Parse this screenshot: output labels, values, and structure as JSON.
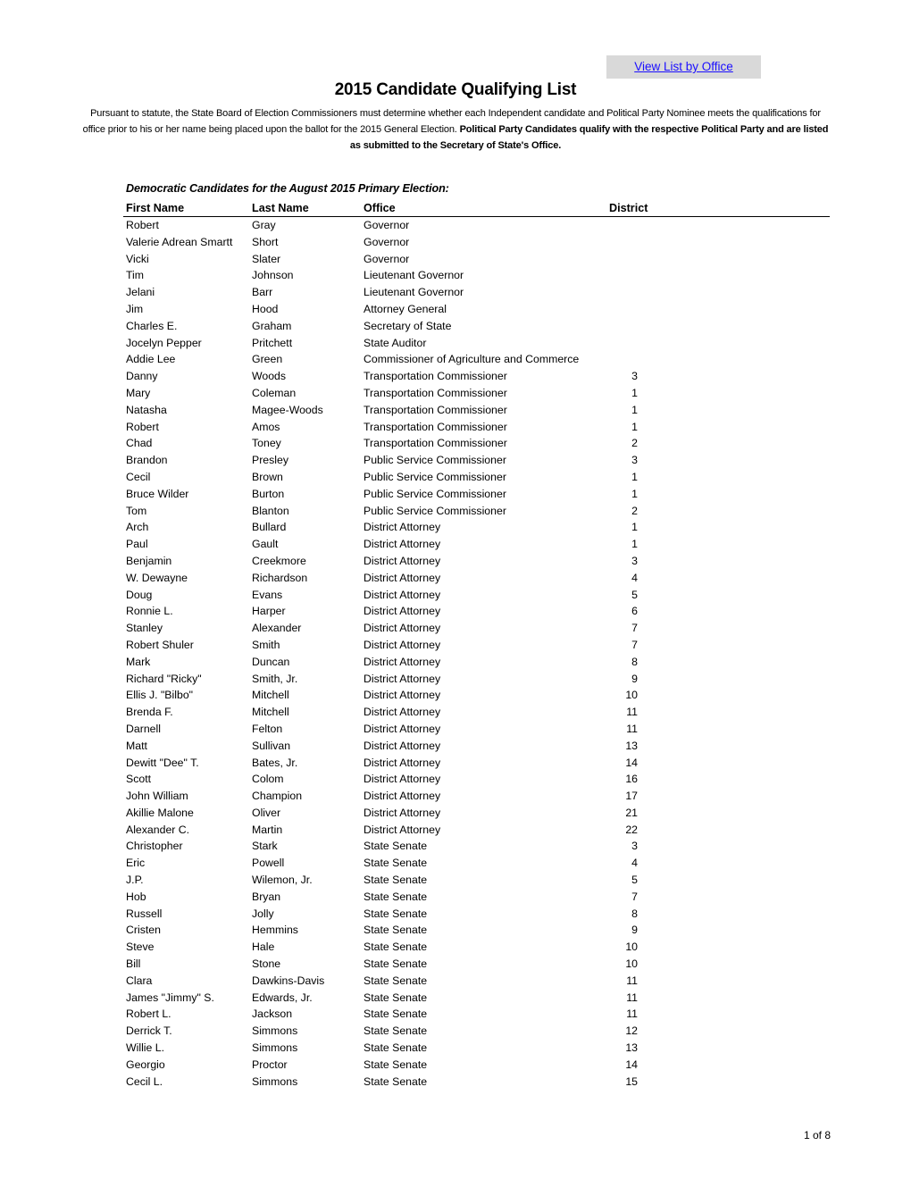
{
  "header": {
    "view_list_button": "View List by Office",
    "title": "2015 Candidate Qualifying List",
    "intro_plain": "Pursuant to statute, the State Board of Election Commissioners must determine whether each Independent candidate and Political Party Nominee meets the qualifications for office prior to his or her name being placed upon the ballot for the 2015 General Election. ",
    "intro_bold": "Political Party Candidates qualify with the respective Political Party and are listed as submitted to the Secretary of State's Office."
  },
  "section": {
    "heading": "Democratic Candidates for the August 2015 Primary Election:",
    "columns": {
      "first": "First Name",
      "last": "Last Name",
      "office": "Office",
      "district": "District"
    },
    "rows": [
      {
        "first": "Robert",
        "last": "Gray",
        "office": "Governor",
        "district": ""
      },
      {
        "first": "Valerie Adrean Smartt",
        "last": "Short",
        "office": "Governor",
        "district": ""
      },
      {
        "first": "Vicki",
        "last": "Slater",
        "office": "Governor",
        "district": ""
      },
      {
        "first": "Tim",
        "last": "Johnson",
        "office": "Lieutenant Governor",
        "district": ""
      },
      {
        "first": "Jelani",
        "last": "Barr",
        "office": "Lieutenant Governor",
        "district": ""
      },
      {
        "first": "Jim",
        "last": "Hood",
        "office": "Attorney General",
        "district": ""
      },
      {
        "first": "Charles E.",
        "last": "Graham",
        "office": "Secretary of State",
        "district": ""
      },
      {
        "first": "Jocelyn Pepper",
        "last": "Pritchett",
        "office": "State Auditor",
        "district": ""
      },
      {
        "first": "Addie Lee",
        "last": "Green",
        "office": "Commissioner of Agriculture and Commerce",
        "district": ""
      },
      {
        "first": "Danny",
        "last": "Woods",
        "office": "Transportation Commissioner",
        "district": "3"
      },
      {
        "first": "Mary",
        "last": "Coleman",
        "office": "Transportation Commissioner",
        "district": "1"
      },
      {
        "first": "Natasha",
        "last": "Magee-Woods",
        "office": "Transportation Commissioner",
        "district": "1"
      },
      {
        "first": "Robert",
        "last": "Amos",
        "office": "Transportation Commissioner",
        "district": "1"
      },
      {
        "first": "Chad",
        "last": "Toney",
        "office": "Transportation Commissioner",
        "district": "2"
      },
      {
        "first": "Brandon",
        "last": "Presley",
        "office": "Public Service Commissioner",
        "district": "3"
      },
      {
        "first": "Cecil",
        "last": "Brown",
        "office": "Public Service Commissioner",
        "district": "1"
      },
      {
        "first": "Bruce Wilder",
        "last": "Burton",
        "office": "Public Service Commissioner",
        "district": "1"
      },
      {
        "first": "Tom",
        "last": "Blanton",
        "office": "Public Service Commissioner",
        "district": "2"
      },
      {
        "first": "Arch",
        "last": "Bullard",
        "office": "District Attorney",
        "district": "1"
      },
      {
        "first": "Paul",
        "last": "Gault",
        "office": "District Attorney",
        "district": "1"
      },
      {
        "first": "Benjamin",
        "last": "Creekmore",
        "office": "District Attorney",
        "district": "3"
      },
      {
        "first": "W. Dewayne",
        "last": "Richardson",
        "office": "District Attorney",
        "district": "4"
      },
      {
        "first": "Doug",
        "last": "Evans",
        "office": "District Attorney",
        "district": "5"
      },
      {
        "first": "Ronnie L.",
        "last": "Harper",
        "office": "District Attorney",
        "district": "6"
      },
      {
        "first": "Stanley",
        "last": "Alexander",
        "office": "District Attorney",
        "district": "7"
      },
      {
        "first": "Robert Shuler",
        "last": "Smith",
        "office": "District Attorney",
        "district": "7"
      },
      {
        "first": "Mark",
        "last": "Duncan",
        "office": "District Attorney",
        "district": "8"
      },
      {
        "first": "Richard \"Ricky\"",
        "last": "Smith, Jr.",
        "office": "District Attorney",
        "district": "9"
      },
      {
        "first": "Ellis J. \"Bilbo\"",
        "last": "Mitchell",
        "office": "District Attorney",
        "district": "10"
      },
      {
        "first": "Brenda F.",
        "last": "Mitchell",
        "office": "District Attorney",
        "district": "11"
      },
      {
        "first": "Darnell",
        "last": "Felton",
        "office": "District Attorney",
        "district": "11"
      },
      {
        "first": "Matt",
        "last": "Sullivan",
        "office": "District Attorney",
        "district": "13"
      },
      {
        "first": "Dewitt \"Dee\" T.",
        "last": "Bates, Jr.",
        "office": "District Attorney",
        "district": "14"
      },
      {
        "first": "Scott",
        "last": "Colom",
        "office": "District Attorney",
        "district": "16"
      },
      {
        "first": "John William",
        "last": "Champion",
        "office": "District Attorney",
        "district": "17"
      },
      {
        "first": "Akillie Malone",
        "last": "Oliver",
        "office": "District Attorney",
        "district": "21"
      },
      {
        "first": "Alexander C.",
        "last": "Martin",
        "office": "District Attorney",
        "district": "22"
      },
      {
        "first": "Christopher",
        "last": "Stark",
        "office": "State Senate",
        "district": "3"
      },
      {
        "first": "Eric",
        "last": "Powell",
        "office": "State Senate",
        "district": "4"
      },
      {
        "first": "J.P.",
        "last": "Wilemon, Jr.",
        "office": "State Senate",
        "district": "5"
      },
      {
        "first": "Hob",
        "last": "Bryan",
        "office": "State Senate",
        "district": "7"
      },
      {
        "first": "Russell",
        "last": "Jolly",
        "office": "State Senate",
        "district": "8"
      },
      {
        "first": "Cristen",
        "last": "Hemmins",
        "office": "State Senate",
        "district": "9"
      },
      {
        "first": "Steve",
        "last": "Hale",
        "office": "State Senate",
        "district": "10"
      },
      {
        "first": "Bill",
        "last": "Stone",
        "office": "State Senate",
        "district": "10"
      },
      {
        "first": "Clara",
        "last": "Dawkins-Davis",
        "office": "State Senate",
        "district": "11"
      },
      {
        "first": "James \"Jimmy\" S.",
        "last": "Edwards, Jr.",
        "office": "State Senate",
        "district": "11"
      },
      {
        "first": "Robert L.",
        "last": "Jackson",
        "office": "State Senate",
        "district": "11"
      },
      {
        "first": "Derrick T.",
        "last": "Simmons",
        "office": "State Senate",
        "district": "12"
      },
      {
        "first": "Willie L.",
        "last": "Simmons",
        "office": "State Senate",
        "district": "13"
      },
      {
        "first": "Georgio",
        "last": "Proctor",
        "office": "State Senate",
        "district": "14"
      },
      {
        "first": "Cecil L.",
        "last": "Simmons",
        "office": "State Senate",
        "district": "15"
      }
    ]
  },
  "footer": {
    "page_number": "1 of 8"
  }
}
